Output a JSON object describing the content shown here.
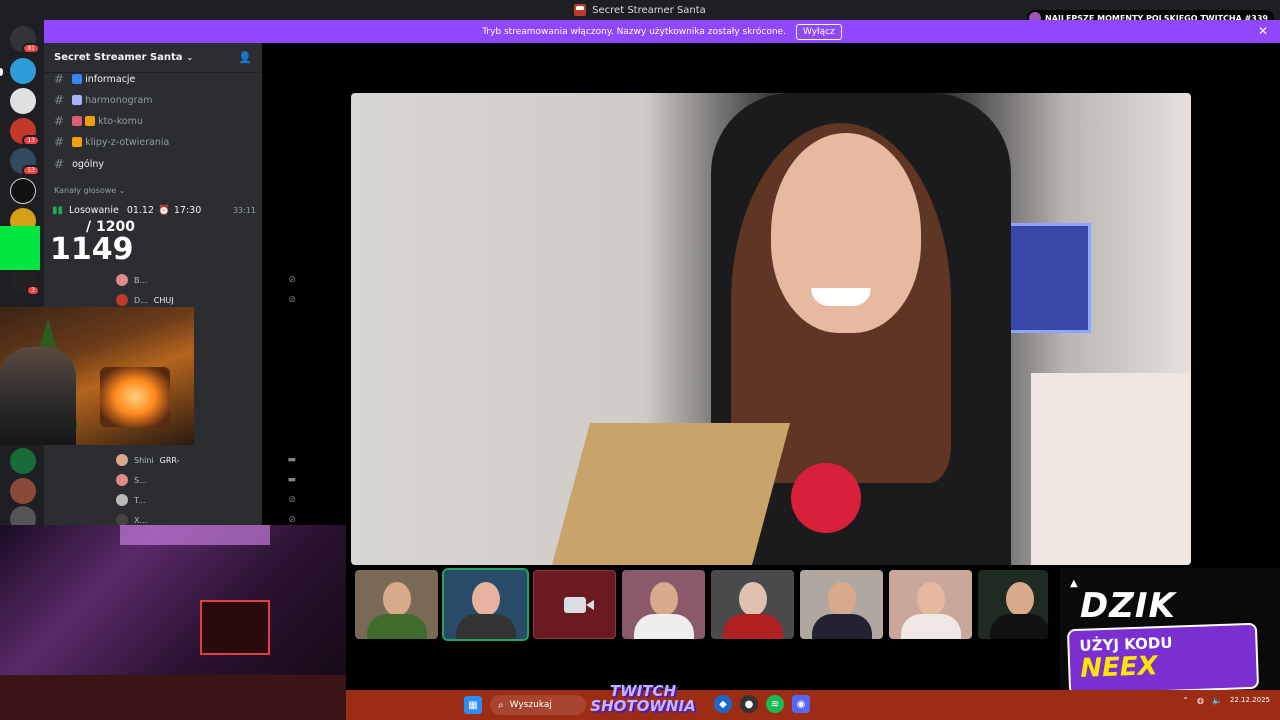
{
  "window": {
    "title": "Secret Streamer Santa"
  },
  "notice": {
    "text": "Tryb streamowania włączony. Nazwy użytkownika zostały skrócone.",
    "button": "Wyłącz"
  },
  "overlay": {
    "text": "NAJLEPSZE MOMENTY POLSKIEGO TWITCHA #339"
  },
  "guilds": {
    "badges": [
      "81",
      "13",
      "53",
      "3"
    ]
  },
  "server": {
    "name": "Secret Streamer Santa",
    "text_channels": [
      {
        "name": "informacje",
        "bright": true
      },
      {
        "name": "harmonogram",
        "bright": false
      },
      {
        "name": "kto-komu",
        "bright": false
      },
      {
        "name": "klipy-z-otwierania",
        "bright": false
      },
      {
        "name": "ogólny",
        "bright": true
      }
    ],
    "voice_category": "Kanały głosowe",
    "voice_channel": {
      "name": "Losowanie",
      "date": "01.12",
      "time": "17:30",
      "elapsed": "33:11"
    },
    "members": [
      {
        "name": "B...",
        "status": ""
      },
      {
        "name": "D...",
        "status": "CHUJ"
      },
      {
        "name": "Shini",
        "status": "GRR-"
      },
      {
        "name": "S...",
        "status": ""
      },
      {
        "name": "T...",
        "status": ""
      },
      {
        "name": "X...",
        "status": ""
      }
    ]
  },
  "counter": {
    "goal": "/ 1200",
    "current": "1149"
  },
  "ad": {
    "brand": "DZIK",
    "code_label": "UŻYJ KODU",
    "code_value": "NEEX"
  },
  "watermark": {
    "line1": "TWITCH",
    "line2": "SHOTOWNIA"
  },
  "taskbar": {
    "search_placeholder": "Wyszukaj",
    "time": "",
    "date": "22.12.2025"
  }
}
